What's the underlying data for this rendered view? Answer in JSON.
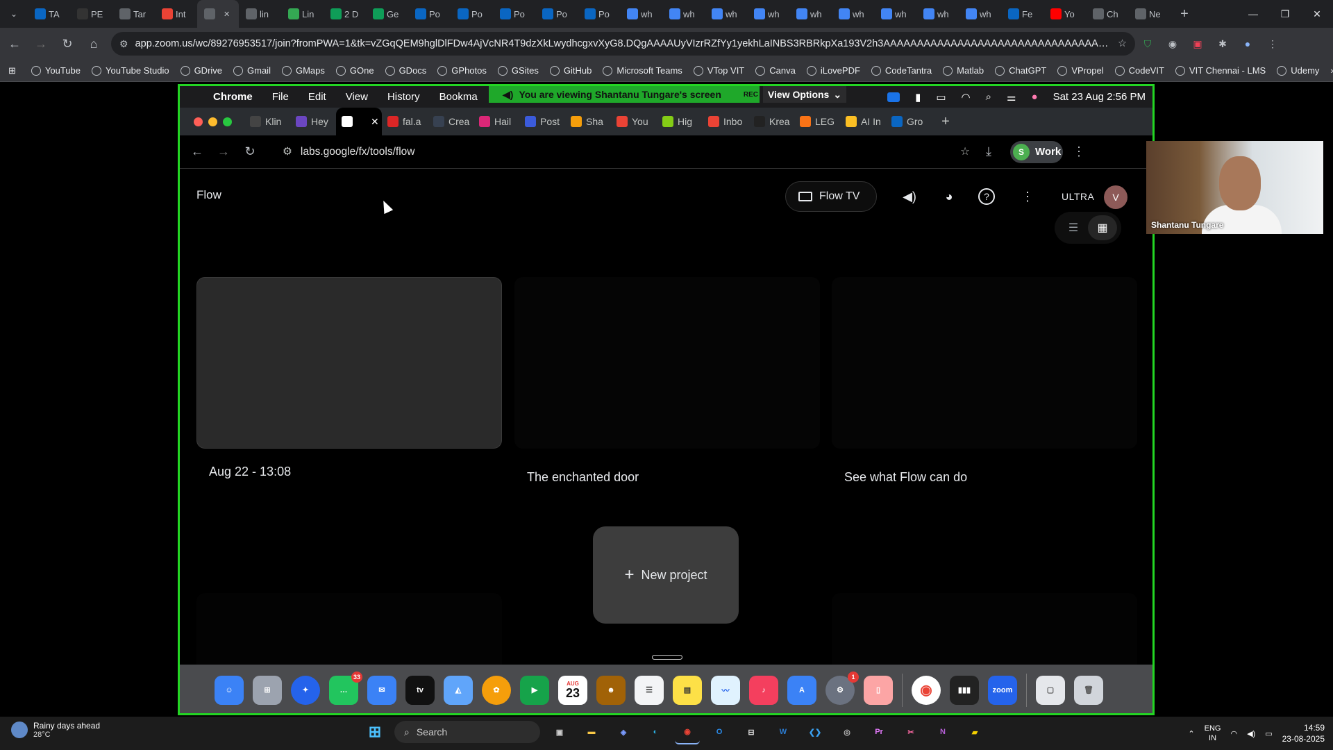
{
  "outer_browser": {
    "tabs": [
      {
        "label": "TA",
        "icon": "linkedin-icon",
        "color": "#0a66c2"
      },
      {
        "label": "PE",
        "icon": "github-icon",
        "color": "#333333"
      },
      {
        "label": "Tar",
        "icon": "globe-icon",
        "color": "#5f6368"
      },
      {
        "label": "Int",
        "icon": "gmail-icon",
        "color": "#ea4335"
      },
      {
        "label": "",
        "icon": "speaker-icon",
        "color": "#5f6368",
        "active": true
      },
      {
        "label": "lin",
        "icon": "globe-icon",
        "color": "#5f6368"
      },
      {
        "label": "Lin",
        "icon": "dots-icon",
        "color": "#34a853"
      },
      {
        "label": "2 D",
        "icon": "sheets-icon",
        "color": "#0f9d58"
      },
      {
        "label": "Ge",
        "icon": "sheets-icon",
        "color": "#0f9d58"
      },
      {
        "label": "Po",
        "icon": "linkedin-icon",
        "color": "#0a66c2"
      },
      {
        "label": "Po",
        "icon": "linkedin-icon",
        "color": "#0a66c2"
      },
      {
        "label": "Po",
        "icon": "linkedin-icon",
        "color": "#0a66c2"
      },
      {
        "label": "Po",
        "icon": "linkedin-icon",
        "color": "#0a66c2"
      },
      {
        "label": "Po",
        "icon": "linkedin-icon",
        "color": "#0a66c2"
      },
      {
        "label": "wh",
        "icon": "google-icon",
        "color": "#4285f4"
      },
      {
        "label": "wh",
        "icon": "google-icon",
        "color": "#4285f4"
      },
      {
        "label": "wh",
        "icon": "google-icon",
        "color": "#4285f4"
      },
      {
        "label": "wh",
        "icon": "google-icon",
        "color": "#4285f4"
      },
      {
        "label": "wh",
        "icon": "google-icon",
        "color": "#4285f4"
      },
      {
        "label": "wh",
        "icon": "google-icon",
        "color": "#4285f4"
      },
      {
        "label": "wh",
        "icon": "google-icon",
        "color": "#4285f4"
      },
      {
        "label": "wh",
        "icon": "google-icon",
        "color": "#4285f4"
      },
      {
        "label": "wh",
        "icon": "google-icon",
        "color": "#4285f4"
      },
      {
        "label": "Fe",
        "icon": "linkedin-icon",
        "color": "#0a66c2"
      },
      {
        "label": "Yo",
        "icon": "youtube-icon",
        "color": "#ff0000"
      },
      {
        "label": "Ch",
        "icon": "chatgpt-icon",
        "color": "#5f6368"
      },
      {
        "label": "Ne",
        "icon": "chatgpt-icon",
        "color": "#5f6368"
      }
    ],
    "url": "app.zoom.us/wc/89276953517/join?fromPWA=1&tk=vZGqQEM9hglDlFDw4AjVcNR4T9dzXkLwydhcgxvXyG8.DQgAAAAUyVIzrRZfYy1yekhLaINBS3RBRkpXa193V2h3AAAAAAAAAAAAAAAAAAAAAAAAAAAAAAAAAAAAAAAAAA&_x_zm_r...",
    "bookmarks": [
      "YouTube",
      "YouTube Studio",
      "GDrive",
      "Gmail",
      "GMaps",
      "GOne",
      "GDocs",
      "GPhotos",
      "GSites",
      "GitHub",
      "Microsoft Teams",
      "VTop VIT",
      "Canva",
      "iLovePDF",
      "CodeTantra",
      "Matlab",
      "ChatGPT",
      "VPropel",
      "CodeVIT",
      "VIT Chennai - LMS",
      "Udemy"
    ]
  },
  "mac": {
    "menu": [
      "Chrome",
      "File",
      "Edit",
      "View",
      "History",
      "Bookma"
    ],
    "viewing_banner": "You are viewing  Shantanu Tungare's screen",
    "rec_label": "REC",
    "view_options": "View Options",
    "datetime": "Sat 23 Aug  2:56 PM"
  },
  "inner_browser": {
    "tabs": [
      "Klin",
      "Hey",
      "",
      "fal.a",
      "Crea",
      "Hail",
      "Post",
      "Sha",
      "You",
      "Hig",
      "Inbo",
      "Krea",
      "LEG",
      "AI In",
      "Gro"
    ],
    "url": "labs.google/fx/tools/flow",
    "profile_label": "Work",
    "profile_initial": "S"
  },
  "flow": {
    "title": "Flow",
    "flow_tv": "Flow TV",
    "plan": "ULTRA",
    "avatar_initial": "V",
    "projects": [
      {
        "label": "Aug 22 - 13:08"
      },
      {
        "label": "The enchanted door"
      },
      {
        "label": "See what Flow can do"
      }
    ],
    "new_project": "New project"
  },
  "dock": {
    "messages_badge": "33",
    "settings_badge": "1",
    "calendar_month": "AUG",
    "calendar_day": "23"
  },
  "participant": {
    "name": "Shantanu Tungare"
  },
  "taskbar": {
    "weather_title": "Rainy days ahead",
    "weather_temp": "28°C",
    "search": "Search",
    "lang": "ENG",
    "region": "IN",
    "time": "14:59",
    "date": "23-08-2025"
  }
}
